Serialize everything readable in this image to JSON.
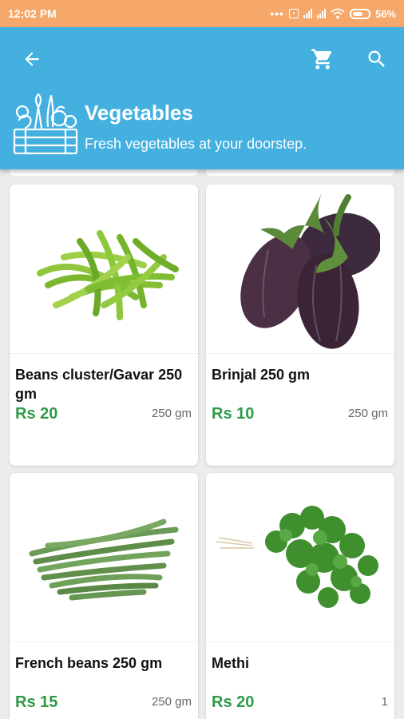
{
  "status_bar": {
    "time": "12:02 PM",
    "battery": "56%"
  },
  "header": {
    "title": "Vegetables",
    "subtitle": "Fresh vegetables at your doorstep.",
    "icons": [
      "back-arrow-icon",
      "cart-icon",
      "search-icon",
      "vegetable-basket-icon"
    ],
    "background_color": "#43b0e0"
  },
  "products": [
    {
      "name": "Beans cluster/Gavar 250 gm",
      "price": "Rs 20",
      "weight": "250 gm",
      "image": "cluster-beans"
    },
    {
      "name": "Brinjal 250 gm",
      "price": "Rs 10",
      "weight": "250 gm",
      "image": "brinjal"
    },
    {
      "name": "French beans 250 gm",
      "price": "Rs 15",
      "weight": "250 gm",
      "image": "french-beans"
    },
    {
      "name": "Methi",
      "price": "Rs 20",
      "weight": "1",
      "image": "methi"
    }
  ],
  "colors": {
    "status_bar": "#f5a86a",
    "price": "#2e9a47",
    "page_background": "#ececec"
  }
}
